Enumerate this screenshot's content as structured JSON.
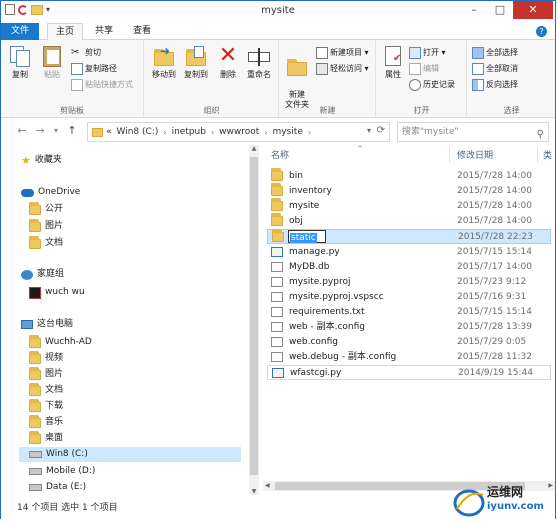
{
  "window": {
    "title": "mysite"
  },
  "tabs": [
    {
      "label": "文件"
    },
    {
      "label": "主页"
    },
    {
      "label": "共享"
    },
    {
      "label": "查看"
    }
  ],
  "ribbon": {
    "clipboard": {
      "label": "剪贴板",
      "copy": "复制",
      "paste": "粘贴",
      "cut": "剪切",
      "copy_path": "复制路径",
      "paste_shortcut": "粘贴快捷方式"
    },
    "organize": {
      "label": "组织",
      "move_to": "移动到",
      "copy_to": "复制到",
      "delete": "删除",
      "rename": "重命名"
    },
    "new": {
      "label": "新建",
      "new_folder": "新建\n文件夹",
      "new_item": "新建项目 ▾",
      "easy_access": "轻松访问 ▾"
    },
    "open": {
      "label": "打开",
      "properties": "属性",
      "open": "打开 ▾",
      "edit": "编辑",
      "history": "历史记录"
    },
    "select": {
      "label": "选择",
      "select_all": "全部选择",
      "select_none": "全部取消",
      "invert": "反向选择"
    }
  },
  "address": {
    "crumbs": [
      "«",
      "Win8 (C:)",
      "inetpub",
      "wwwroot",
      "mysite"
    ],
    "search_placeholder": "搜索\"mysite\""
  },
  "navpane": {
    "items": [
      {
        "label": "收藏夹",
        "icon": "star-icon"
      },
      {
        "label": "OneDrive",
        "icon": "cloud-icon"
      },
      {
        "label": "公开",
        "icon": "folder-icon"
      },
      {
        "label": "图片",
        "icon": "folder-icon"
      },
      {
        "label": "文档",
        "icon": "folder-icon"
      },
      {
        "label": "家庭组",
        "icon": "homegroup-icon"
      },
      {
        "label": "wuch wu",
        "icon": "user-icon"
      },
      {
        "label": "这台电脑",
        "icon": "computer-icon"
      },
      {
        "label": "Wuchh-AD",
        "icon": "folder-icon"
      },
      {
        "label": "视频",
        "icon": "folder-icon"
      },
      {
        "label": "图片",
        "icon": "folder-icon"
      },
      {
        "label": "文档",
        "icon": "folder-icon"
      },
      {
        "label": "下载",
        "icon": "folder-icon"
      },
      {
        "label": "音乐",
        "icon": "folder-icon"
      },
      {
        "label": "桌面",
        "icon": "folder-icon"
      },
      {
        "label": "Win8 (C:)",
        "icon": "drive-icon"
      },
      {
        "label": "Mobile (D:)",
        "icon": "drive-icon"
      },
      {
        "label": "Data (E:)",
        "icon": "drive-icon"
      }
    ]
  },
  "filelist": {
    "headers": {
      "name": "名称",
      "date": "修改日期",
      "type": "类"
    },
    "rows": [
      {
        "name": "bin",
        "date": "2015/7/28 14:00",
        "kind": "folder"
      },
      {
        "name": "inventory",
        "date": "2015/7/28 14:00",
        "kind": "folder"
      },
      {
        "name": "mysite",
        "date": "2015/7/28 14:00",
        "kind": "folder"
      },
      {
        "name": "obj",
        "date": "2015/7/28 14:00",
        "kind": "folder"
      },
      {
        "name": "static",
        "date": "2015/7/28 22:23",
        "kind": "folder"
      },
      {
        "name": "manage.py",
        "date": "2015/7/15 15:14",
        "kind": "py"
      },
      {
        "name": "MyDB.db",
        "date": "2015/7/17 14:00",
        "kind": "file"
      },
      {
        "name": "mysite.pyproj",
        "date": "2015/7/23 9:12",
        "kind": "file"
      },
      {
        "name": "mysite.pyproj.vspscc",
        "date": "2015/7/16 9:31",
        "kind": "file"
      },
      {
        "name": "requirements.txt",
        "date": "2015/7/15 15:14",
        "kind": "file"
      },
      {
        "name": "web - 副本.config",
        "date": "2015/7/28 13:39",
        "kind": "file"
      },
      {
        "name": "web.config",
        "date": "2015/7/29 0:05",
        "kind": "file"
      },
      {
        "name": "web.debug - 副本.config",
        "date": "2015/7/28 11:32",
        "kind": "file"
      },
      {
        "name": "wfastcgi.py",
        "date": "2014/9/19 15:44",
        "kind": "py"
      }
    ]
  },
  "status": {
    "text": "14 个项目    选中 1 个项目"
  },
  "watermark": {
    "brand": "运维网",
    "domain": "iyunv.com"
  },
  "colors": {
    "accent": "#1979ca",
    "selection": "#cde8ff",
    "close": "#c7312e"
  }
}
